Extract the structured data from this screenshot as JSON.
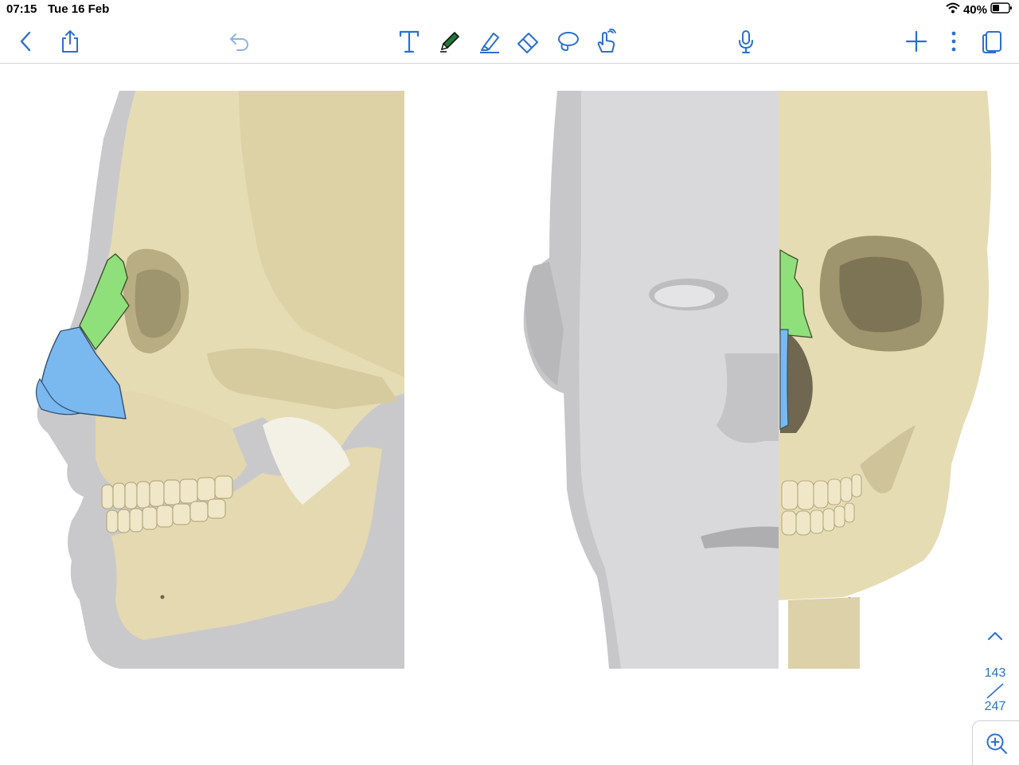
{
  "status_bar": {
    "time": "07:15",
    "date": "Tue 16 Feb",
    "battery": "40%",
    "icons": [
      "wifi-icon",
      "battery-icon"
    ]
  },
  "toolbar": {
    "accent_color": "#2b6fd1",
    "pen_color": "#1f7a3a",
    "buttons": [
      "back",
      "share",
      "undo",
      "text-tool",
      "pen-tool",
      "highlighter-tool",
      "eraser-tool",
      "lasso-tool",
      "hand-tool",
      "microphone",
      "add",
      "more",
      "pages"
    ]
  },
  "document": {
    "illustration_left": "lateral skull with nasal bone (green) and nasal cartilage (blue)",
    "illustration_right": "frontal half face / half skull",
    "highlight_colors": {
      "nasal_bone": "#8fe07a",
      "cartilage": "#7ab8f0"
    }
  },
  "pager": {
    "current": "143",
    "total": "247"
  }
}
